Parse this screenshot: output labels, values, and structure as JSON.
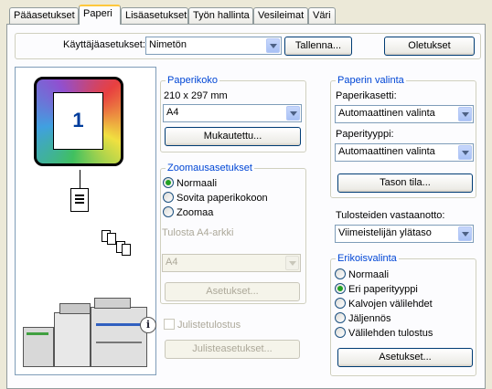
{
  "tabs": [
    {
      "label": "Pääasetukset"
    },
    {
      "label": "Paperi"
    },
    {
      "label": "Lisäasetukset"
    },
    {
      "label": "Työn hallinta"
    },
    {
      "label": "Vesileimat"
    },
    {
      "label": "Väri"
    }
  ],
  "user_settings": {
    "label": "Käyttäjäasetukset:",
    "value": "Nimetön",
    "save_label": "Tallenna...",
    "defaults_label": "Oletukset"
  },
  "preview": {
    "page_number": "1"
  },
  "paper_size": {
    "title": "Paperikoko",
    "dimensions": "210 x 297 mm",
    "value": "A4",
    "custom_label": "Mukautettu..."
  },
  "zoom": {
    "title": "Zoomausasetukset",
    "options": [
      "Normaali",
      "Sovita paperikokoon",
      "Zoomaa"
    ],
    "selected": "Normaali",
    "print_sheet_label": "Tulosta A4-arkki",
    "print_sheet_value": "A4",
    "settings_label": "Asetukset..."
  },
  "poster": {
    "checkbox_label": "Julistetulostus",
    "settings_label": "Julisteasetukset..."
  },
  "paper_selection": {
    "title": "Paperin valinta",
    "tray_label": "Paperikasetti:",
    "tray_value": "Automaattinen valinta",
    "type_label": "Paperityyppi:",
    "type_value": "Automaattinen valinta",
    "tray_status_label": "Tason tila..."
  },
  "output": {
    "label": "Tulosteiden vastaanotto:",
    "value": "Viimeistelijän ylätaso"
  },
  "special": {
    "title": "Erikoisvalinta",
    "options": [
      "Normaali",
      "Eri paperityyppi",
      "Kalvojen välilehdet",
      "Jäljennös",
      "Välilehden tulostus"
    ],
    "selected": "Eri paperityyppi",
    "settings_label": "Asetukset..."
  }
}
